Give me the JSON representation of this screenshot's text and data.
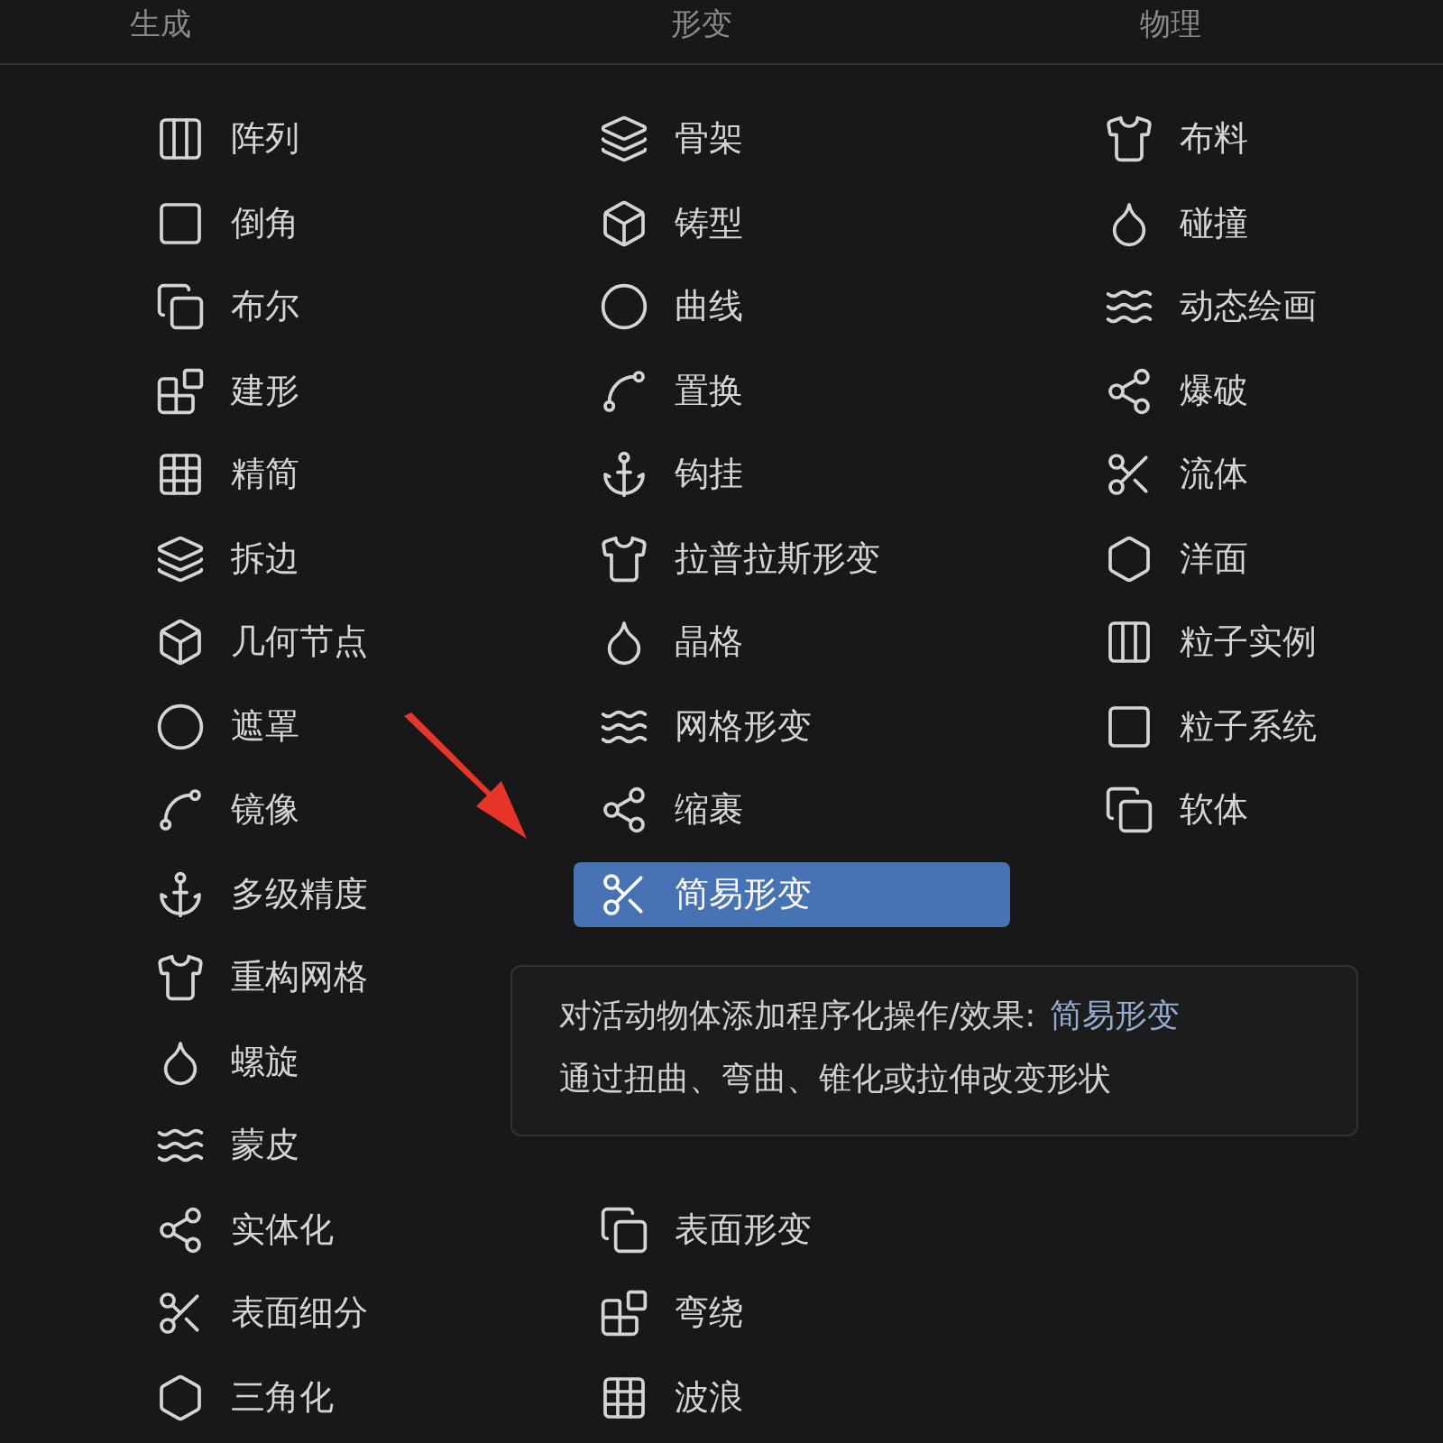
{
  "columns": [
    {
      "header": "生成",
      "items": [
        {
          "kind": "item",
          "label": "阵列",
          "selected": false
        },
        {
          "kind": "item",
          "label": "倒角",
          "selected": false
        },
        {
          "kind": "item",
          "label": "布尔",
          "selected": false
        },
        {
          "kind": "item",
          "label": "建形",
          "selected": false
        },
        {
          "kind": "item",
          "label": "精简",
          "selected": false
        },
        {
          "kind": "item",
          "label": "拆边",
          "selected": false
        },
        {
          "kind": "item",
          "label": "几何节点",
          "selected": false
        },
        {
          "kind": "item",
          "label": "遮罩",
          "selected": false
        },
        {
          "kind": "item",
          "label": "镜像",
          "selected": false
        },
        {
          "kind": "item",
          "label": "多级精度",
          "selected": false
        },
        {
          "kind": "item",
          "label": "重构网格",
          "selected": false
        },
        {
          "kind": "item",
          "label": "螺旋",
          "selected": false
        },
        {
          "kind": "item",
          "label": "蒙皮",
          "selected": false
        },
        {
          "kind": "item",
          "label": "实体化",
          "selected": false
        },
        {
          "kind": "item",
          "label": "表面细分",
          "selected": false
        },
        {
          "kind": "item",
          "label": "三角化",
          "selected": false
        }
      ]
    },
    {
      "header": "形变",
      "items": [
        {
          "kind": "item",
          "label": "骨架",
          "selected": false
        },
        {
          "kind": "item",
          "label": "铸型",
          "selected": false
        },
        {
          "kind": "item",
          "label": "曲线",
          "selected": false
        },
        {
          "kind": "item",
          "label": "置换",
          "selected": false
        },
        {
          "kind": "item",
          "label": "钩挂",
          "selected": false
        },
        {
          "kind": "item",
          "label": "拉普拉斯形变",
          "selected": false
        },
        {
          "kind": "item",
          "label": "晶格",
          "selected": false
        },
        {
          "kind": "item",
          "label": "网格形变",
          "selected": false
        },
        {
          "kind": "item",
          "label": "缩裹",
          "selected": false
        },
        {
          "kind": "item",
          "label": "简易形变",
          "selected": true
        },
        {
          "kind": "blank"
        },
        {
          "kind": "blank"
        },
        {
          "kind": "blank"
        },
        {
          "kind": "item",
          "label": "表面形变",
          "selected": false
        },
        {
          "kind": "item",
          "label": "弯绕",
          "selected": false
        },
        {
          "kind": "item",
          "label": "波浪",
          "selected": false
        }
      ]
    },
    {
      "header": "物理",
      "items": [
        {
          "kind": "item",
          "label": "布料",
          "selected": false
        },
        {
          "kind": "item",
          "label": "碰撞",
          "selected": false
        },
        {
          "kind": "item",
          "label": "动态绘画",
          "selected": false
        },
        {
          "kind": "item",
          "label": "爆破",
          "selected": false
        },
        {
          "kind": "item",
          "label": "流体",
          "selected": false
        },
        {
          "kind": "item",
          "label": "洋面",
          "selected": false
        },
        {
          "kind": "item",
          "label": "粒子实例",
          "selected": false
        },
        {
          "kind": "item",
          "label": "粒子系统",
          "selected": false
        },
        {
          "kind": "item",
          "label": "软体",
          "selected": false
        }
      ]
    }
  ],
  "tooltip": {
    "text": "对活动物体添加程序化操作/效果:",
    "name": "简易形变",
    "description": "通过扭曲、弯曲、锥化或拉伸改变形状"
  }
}
